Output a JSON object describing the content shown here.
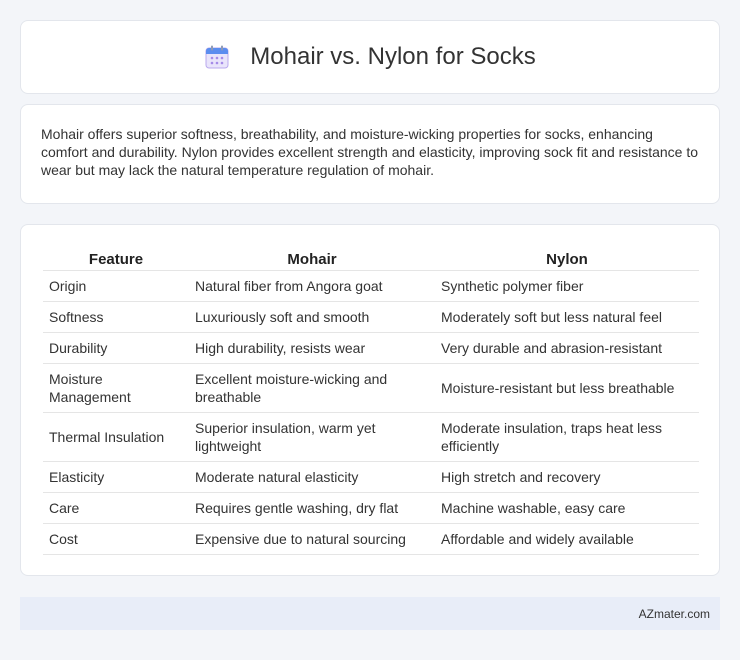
{
  "header": {
    "icon": "calendar-icon",
    "title": "Mohair vs. Nylon for Socks"
  },
  "intro": {
    "text": "Mohair offers superior softness, breathability, and moisture-wicking properties for socks, enhancing comfort and durability. Nylon provides excellent strength and elasticity, improving sock fit and resistance to wear but may lack the natural temperature regulation of mohair."
  },
  "table": {
    "headers": [
      "Feature",
      "Mohair",
      "Nylon"
    ],
    "rows": [
      [
        "Origin",
        "Natural fiber from Angora goat",
        "Synthetic polymer fiber"
      ],
      [
        "Softness",
        "Luxuriously soft and smooth",
        "Moderately soft but less natural feel"
      ],
      [
        "Durability",
        "High durability, resists wear",
        "Very durable and abrasion-resistant"
      ],
      [
        "Moisture Management",
        "Excellent moisture-wicking and breathable",
        "Moisture-resistant but less breathable"
      ],
      [
        "Thermal Insulation",
        "Superior insulation, warm yet lightweight",
        "Moderate insulation, traps heat less efficiently"
      ],
      [
        "Elasticity",
        "Moderate natural elasticity",
        "High stretch and recovery"
      ],
      [
        "Care",
        "Requires gentle washing, dry flat",
        "Machine washable, easy care"
      ],
      [
        "Cost",
        "Expensive due to natural sourcing",
        "Affordable and widely available"
      ]
    ]
  },
  "footer": {
    "site": "AZmater.com"
  },
  "colors": {
    "background": "#f3f5f9",
    "card": "#ffffff",
    "footer": "#e8edf8",
    "icon_top": "#5b8def",
    "icon_body": "#e9e4fb"
  }
}
